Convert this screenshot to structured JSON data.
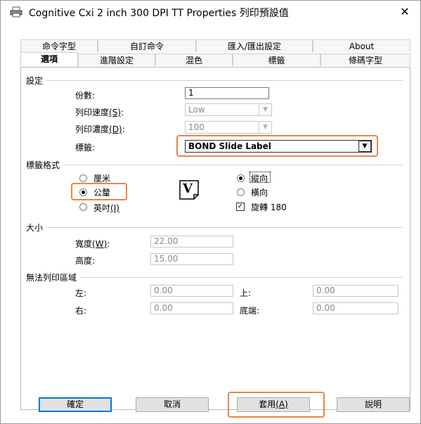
{
  "window": {
    "title": "Cognitive Cxi 2 inch 300 DPI TT Properties 列印預設值",
    "close_glyph": "✕"
  },
  "tabs_back": [
    "命令字型",
    "自訂命令",
    "匯入/匯出設定",
    "About"
  ],
  "tabs_front": [
    "選項",
    "進階設定",
    "混色",
    "標籤",
    "條碼字型"
  ],
  "settings": {
    "group_label": "設定",
    "copies_label": "份數:",
    "copies_value": "1",
    "speed_label": "列印速度",
    "speed_key": "(S)",
    "speed_suffix": ":",
    "speed_value": "Low",
    "density_label": "列印濃度",
    "density_key": "(D)",
    "density_suffix": ":",
    "density_value": "100",
    "label_label": "標籤:",
    "label_value": "BOND Slide Label"
  },
  "format": {
    "group_label": "標籤格式",
    "unit_cm": "厘米",
    "unit_mm": "公釐",
    "unit_inch": "英吋",
    "unit_inch_key": "(I)",
    "orient_portrait": "縱向",
    "orient_landscape": "橫向",
    "rotate_180": "旋轉 180",
    "selected_unit": "公釐",
    "selected_orientation": "縱向",
    "rotate_checked": true,
    "preview_glyph": "V"
  },
  "size": {
    "group_label": "大小",
    "width_label": "寬度",
    "width_key": "(W)",
    "width_suffix": ":",
    "width_value": "22.00",
    "height_label": "高度:",
    "height_value": "15.00"
  },
  "unprintable": {
    "group_label": "無法列印區域",
    "left_label": "左:",
    "left_value": "0.00",
    "top_label": "上:",
    "top_value": "0.00",
    "right_label": "右:",
    "right_value": "0.00",
    "bottom_label": "底端:",
    "bottom_value": "0.00"
  },
  "buttons": {
    "ok": "確定",
    "cancel": "取消",
    "apply_label": "套用",
    "apply_key": "(A)",
    "help": "說明"
  },
  "colors": {
    "highlight": "#e8844a",
    "default_button_border": "#0078d7"
  }
}
